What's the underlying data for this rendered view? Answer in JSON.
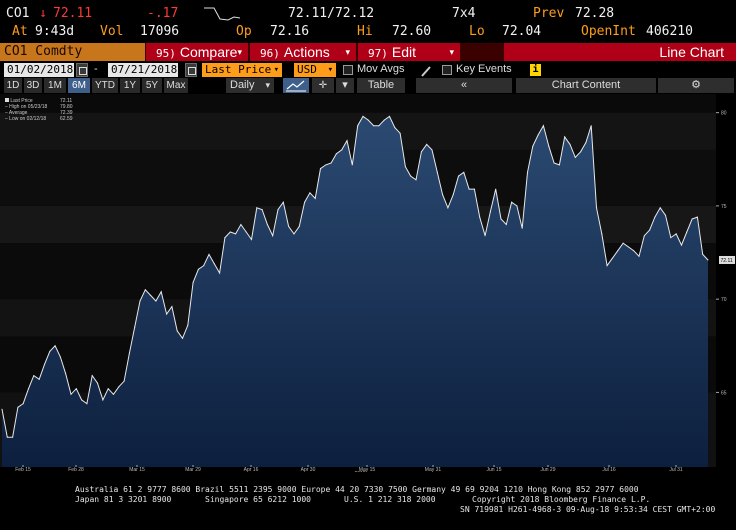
{
  "quote": {
    "ticker": "CO1",
    "last": "72.11",
    "change": "-.17",
    "bid_ask": "72.11/72.12",
    "size": "7x4",
    "prev_label": "Prev",
    "prev": "72.28",
    "at_label": "At",
    "time": "9:43d",
    "vol_label": "Vol",
    "vol": "17096",
    "op_label": "Op",
    "op": "72.16",
    "hi_label": "Hi",
    "hi": "72.60",
    "lo_label": "Lo",
    "lo": "72.04",
    "openint_label": "OpenInt",
    "openint": "406210"
  },
  "toolbar": {
    "security": "CO1 Comdty",
    "compare_num": "95)",
    "compare": "Compare",
    "actions_num": "96)",
    "actions": "Actions",
    "edit_num": "97)",
    "edit": "Edit",
    "line_chart": "Line Chart"
  },
  "settings": {
    "start_date": "01/02/2018",
    "dash": "-",
    "end_date": "07/21/2018",
    "field": "Last Price",
    "currency": "USD",
    "mov_avgs": "Mov Avgs",
    "key_events": "Key Events",
    "info": "i"
  },
  "periods": [
    "1D",
    "3D",
    "1M",
    "6M",
    "YTD",
    "1Y",
    "5Y",
    "Max"
  ],
  "selected_period": "6M",
  "controls": {
    "frequency": "Daily",
    "table": "Table",
    "collapse": "«",
    "chart_content": "Chart Content",
    "gear": "⚙"
  },
  "legend": {
    "last_price": "Last Price",
    "last_value": "72.11",
    "high": "High on 05/23/18",
    "high_value": "79.80",
    "average": "Average",
    "average_value": "72.39",
    "low": "Low on 02/12/18",
    "low_value": "62.59"
  },
  "chart_data": {
    "type": "area",
    "series": [
      {
        "values": [
          64.1,
          62.6,
          62.6,
          64.2,
          64.4,
          65.2,
          65.9,
          65.7,
          66.5,
          67.2,
          67.5,
          66.9,
          66.0,
          64.9,
          65.2,
          64.6,
          64.4,
          65.9,
          65.5,
          64.6,
          65.2,
          64.9,
          65.3,
          65.6,
          67.1,
          68.5,
          69.9,
          70.5,
          70.2,
          69.9,
          70.4,
          69.2,
          69.6,
          68.3,
          67.9,
          68.6,
          70.9,
          71.6,
          71.8,
          72.4,
          71.9,
          71.4,
          73.3,
          73.6,
          73.5,
          74.0,
          73.6,
          73.2,
          74.9,
          74.8,
          74.0,
          73.4,
          74.8,
          75.2,
          73.9,
          73.5,
          73.9,
          75.2,
          75.7,
          75.4,
          77.0,
          77.2,
          77.3,
          77.8,
          78.0,
          78.5,
          77.2,
          79.3,
          79.8,
          79.6,
          79.3,
          79.3,
          79.6,
          79.8,
          79.2,
          78.9,
          77.1,
          76.6,
          76.4,
          77.9,
          78.3,
          78.0,
          76.8,
          75.6,
          74.9,
          75.6,
          76.6,
          76.8,
          75.9,
          75.9,
          74.4,
          73.4,
          74.7,
          75.9,
          74.3,
          74.0,
          75.2,
          75.0,
          73.8,
          76.8,
          78.2,
          78.8,
          79.3,
          78.2,
          77.3,
          77.2,
          78.7,
          78.3,
          77.6,
          77.9,
          78.4,
          79.3,
          74.9,
          73.5,
          71.8,
          72.2,
          72.6,
          73.0,
          72.8,
          72.6,
          72.3,
          73.4,
          73.7,
          74.4,
          74.9,
          74.5,
          73.3,
          73.5,
          72.9,
          73.6,
          74.3,
          74.4,
          72.4,
          72.1
        ]
      }
    ],
    "y_ticks": [
      "65",
      "70",
      "75",
      "80"
    ],
    "ylim": [
      61,
      81
    ],
    "x_ticks": [
      "Feb 15",
      "Feb 28",
      "Mar 15",
      "Mar 29",
      "Apr 16",
      "Apr 30",
      "May 15",
      "May 31",
      "Jun 15",
      "Jun 29",
      "Jul 16",
      "Jul 31"
    ],
    "x_year": "2018",
    "last_label": "72.11"
  },
  "footer": {
    "line1": "Australia 61 2 9777 8600 Brazil 5511 2395 9000 Europe 44 20 7330 7500 Germany 49 69 9204 1210 Hong Kong 852 2977 6000",
    "line2a": "Japan 81 3 3201 8900",
    "line2b": "Singapore 65 6212 1000",
    "line2c": "U.S. 1 212 318 2000",
    "line2d": "Copyright 2018 Bloomberg Finance L.P.",
    "line3": "SN 719981 H261-4968-3 09-Aug-18  9:53:34 CEST GMT+2:00"
  }
}
